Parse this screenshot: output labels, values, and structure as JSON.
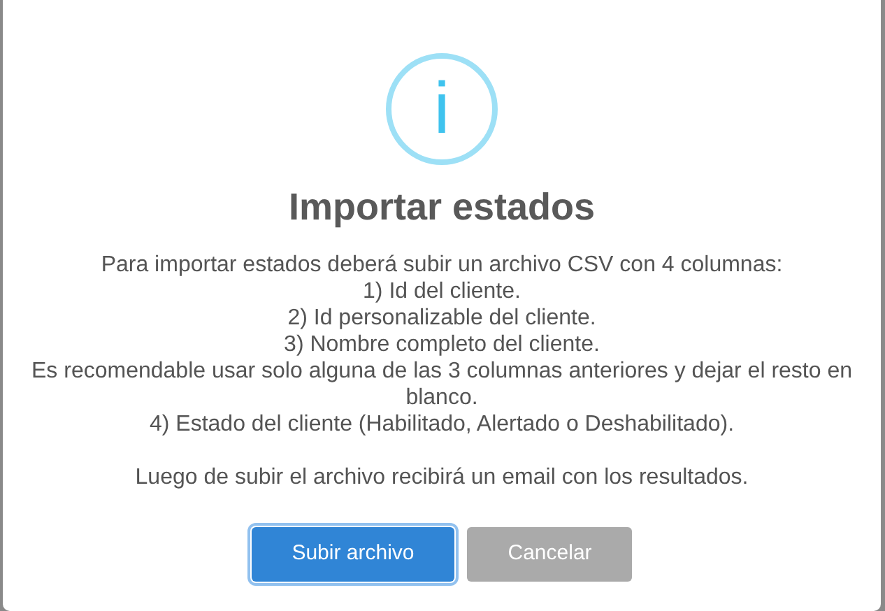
{
  "dialog": {
    "icon_text": "i",
    "title": "Importar estados",
    "lines": [
      "Para importar estados deberá subir un archivo CSV con 4 columnas:",
      "1) Id del cliente.",
      "2) Id personalizable del cliente.",
      "3) Nombre completo del cliente.",
      "Es recomendable usar solo alguna de las 3 columnas anteriores y dejar el resto en blanco.",
      "4) Estado del cliente (Habilitado, Alertado o Deshabilitado)."
    ],
    "note": "Luego de subir el archivo recibirá un email con los resultados.",
    "buttons": [
      {
        "label": "Subir archivo",
        "kind": "confirm",
        "focused": true
      },
      {
        "label": "Cancelar",
        "kind": "cancel",
        "focused": false
      }
    ]
  }
}
